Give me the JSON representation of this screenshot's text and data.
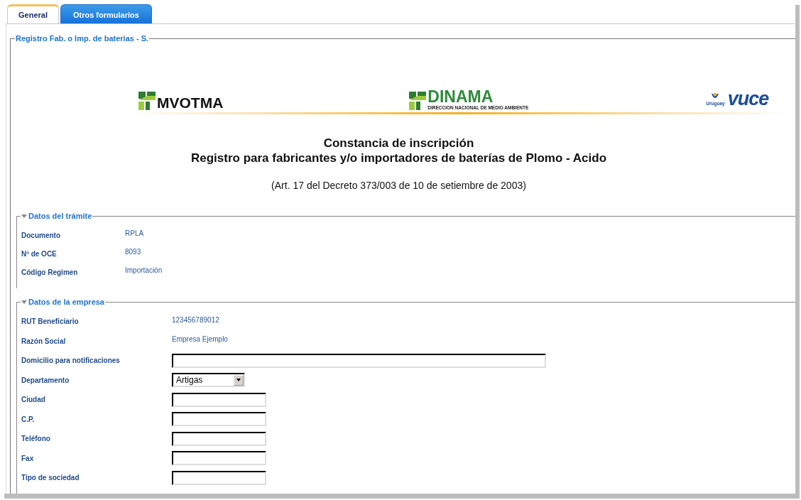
{
  "tabs": [
    {
      "label": "General",
      "selected": true
    },
    {
      "label": "Otros formularios",
      "selected": false
    }
  ],
  "form": {
    "legend": "Registro Fab. o Imp. de baterias - S.",
    "logos": [
      {
        "kind": "mvotma",
        "name": "MVOTMA"
      },
      {
        "kind": "dinama",
        "name": "DINAMA",
        "subtitle": "DIRECCION NACIONAL DE MEDIO AMBIENTE"
      },
      {
        "kind": "vuce",
        "name": "vuce",
        "subtitle": "Uruguay"
      }
    ],
    "title_lines": [
      "Constancia de inscripción",
      "Registro para fabricantes y/o importadores de baterías de Plomo - Acido"
    ],
    "reference": "(Art. 17 del Decreto 373/003 de 10 de setiembre de 2003)",
    "sections": [
      {
        "title": "Datos del trámite",
        "expanded": true,
        "rows": [
          {
            "kind": "text",
            "label": "Documento",
            "value": "RPLA"
          },
          {
            "kind": "text",
            "label": "Nº de OCE",
            "value": "8093"
          },
          {
            "kind": "text",
            "label": "Código Regimen",
            "value": "Importación"
          }
        ]
      },
      {
        "title": "Datos de la empresa",
        "expanded": true,
        "rows": [
          {
            "kind": "text",
            "label": "RUT Beneficiario",
            "value": "123456789012"
          },
          {
            "kind": "text",
            "label": "Razón Social",
            "value": "Empresa Ejemplo"
          },
          {
            "kind": "wide_input",
            "label": "Domicilio para notificaciones"
          },
          {
            "kind": "select",
            "label": "Departamento",
            "value": "Artigas"
          },
          {
            "kind": "input",
            "label": "Ciudad"
          },
          {
            "kind": "input",
            "label": "C.P."
          },
          {
            "kind": "input",
            "label": "Teléfono"
          },
          {
            "kind": "input",
            "label": "Fax"
          },
          {
            "kind": "input",
            "label": "Tipo de sociedad"
          }
        ]
      }
    ]
  }
}
